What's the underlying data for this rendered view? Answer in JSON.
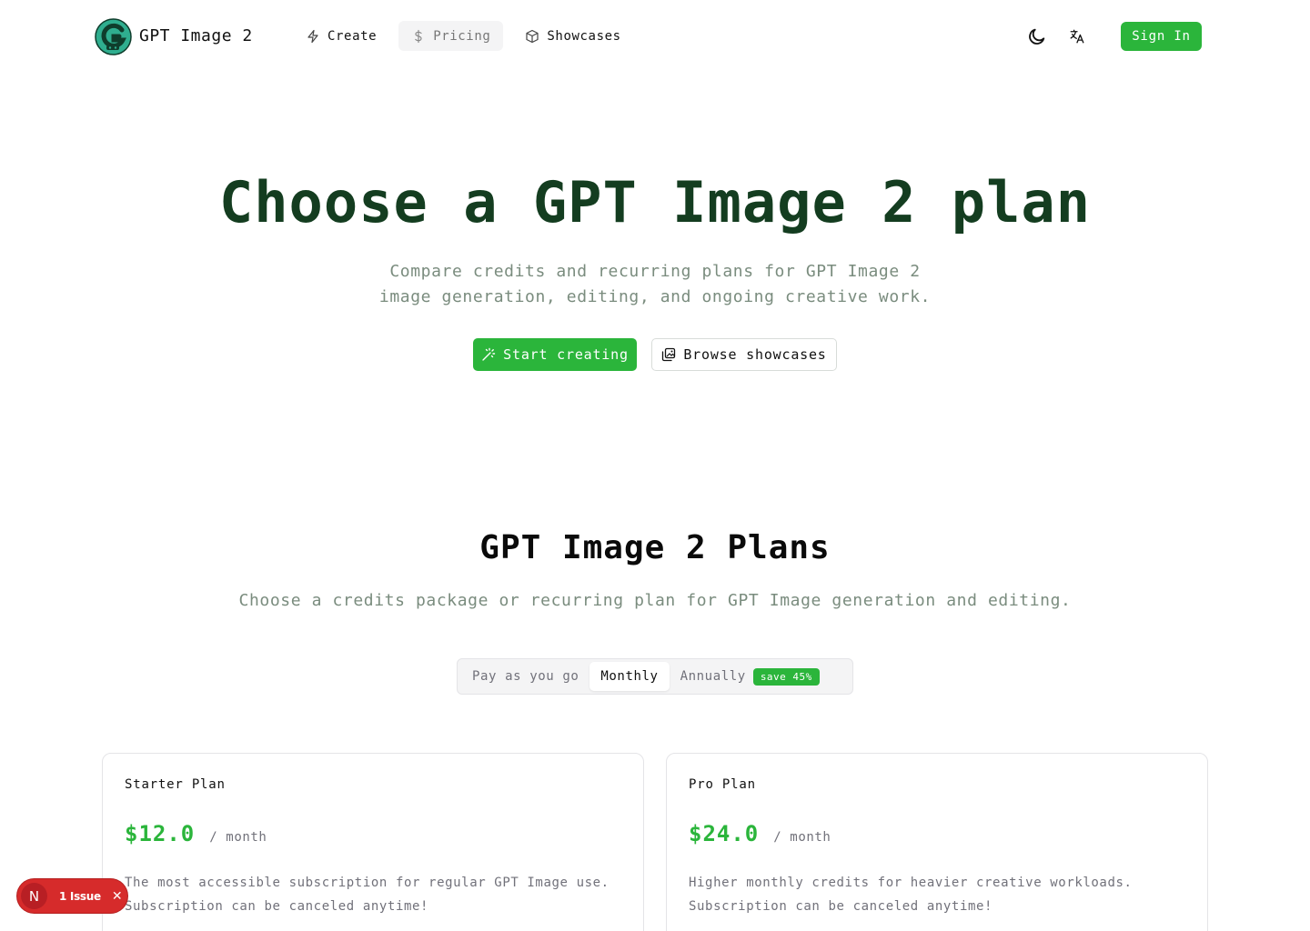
{
  "brand": {
    "name": "GPT Image 2"
  },
  "nav": {
    "items": [
      {
        "label": "Create",
        "icon": "bolt-icon",
        "active": false
      },
      {
        "label": "Pricing",
        "icon": "dollar-icon",
        "active": true
      },
      {
        "label": "Showcases",
        "icon": "box-icon",
        "active": false
      }
    ]
  },
  "header": {
    "theme_icon": "moon-icon",
    "language_icon": "translate-icon",
    "signin_label": "Sign In"
  },
  "hero": {
    "title": "Choose a GPT Image 2 plan",
    "subtitle_line1": "Compare credits and recurring plans for GPT Image 2",
    "subtitle_line2": "image generation, editing, and ongoing creative work.",
    "primary_label": "Start creating",
    "secondary_label": "Browse showcases"
  },
  "plans": {
    "title": "GPT Image 2 Plans",
    "subtitle": "Choose a credits package or recurring plan for GPT Image generation and editing.",
    "toggle": {
      "options": [
        "Pay as you go",
        "Monthly",
        "Annually"
      ],
      "selected": "Monthly",
      "badge": "save 45%"
    },
    "cards": [
      {
        "name": "Starter Plan",
        "price": "$12.0",
        "period": "/ month",
        "description": "The most accessible subscription for regular GPT Image use.",
        "note": "Subscription can be canceled anytime!"
      },
      {
        "name": "Pro Plan",
        "price": "$24.0",
        "period": "/ month",
        "description": "Higher monthly credits for heavier creative workloads.",
        "note": "Subscription can be canceled anytime!"
      }
    ]
  },
  "issue_indicator": {
    "letter": "N",
    "label": "1 Issue"
  },
  "colors": {
    "accent": "#2bb53b",
    "hero_title": "#143d20",
    "muted": "#7a8c7e",
    "issue": "#d62b2b"
  }
}
